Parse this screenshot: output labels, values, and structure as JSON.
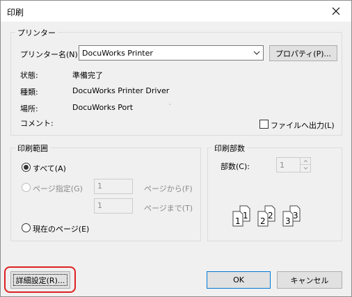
{
  "window": {
    "title": "印刷"
  },
  "printer": {
    "group_label": "プリンター",
    "name_label": "プリンター名(N):",
    "name_value": "DocuWorks Printer",
    "properties_button": "プロパティ(P)...",
    "status_label": "状態:",
    "status_value": "準備完了",
    "type_label": "種類:",
    "type_value": "DocuWorks Printer Driver",
    "location_label": "場所:",
    "location_value": "DocuWorks Port",
    "comment_label": "コメント:",
    "print_to_file_label": "ファイルへ出力(L)",
    "print_to_file_checked": false
  },
  "range": {
    "group_label": "印刷範囲",
    "all_label": "すべて(A)",
    "pages_label": "ページ指定(G)",
    "from_value": "1",
    "from_suffix": "ページから(F)",
    "to_value": "1",
    "to_suffix": "ページまで(T)",
    "current_page_label": "現在のページ(E)",
    "selected": "all"
  },
  "copies": {
    "group_label": "印刷部数",
    "copies_label": "部数(C):",
    "copies_value": "1",
    "collate_pages": [
      "1",
      "1",
      "2",
      "2",
      "3",
      "3"
    ]
  },
  "footer": {
    "advanced_button": "詳細設定(R)...",
    "ok_button": "OK",
    "cancel_button": "キャンセル"
  },
  "colors": {
    "highlight": "#e02020",
    "default_button_border": "#0078d7"
  }
}
